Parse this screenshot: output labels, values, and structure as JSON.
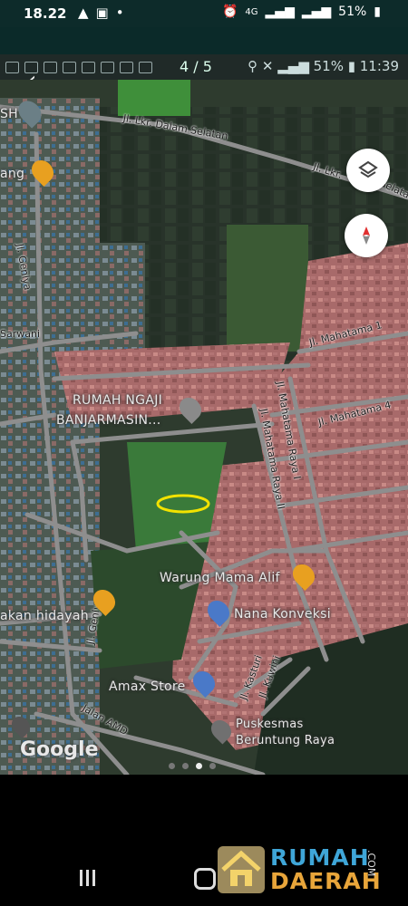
{
  "status_bar": {
    "time": "18.22",
    "battery": "51%",
    "network": "4G"
  },
  "photo_status_bar": {
    "counter": "4 / 5",
    "battery": "51%",
    "time": "11:39"
  },
  "map": {
    "road_labels": [
      "Jl. Lkr. Dalam Selatan",
      "Jl. Lkr.",
      "Selata",
      "Jl. Genlya",
      "Sarwani",
      "Jl. Mahatama 1",
      "Jl. Mahatama 4",
      "Jl. Mahatama Raya I",
      "Jl. Mahatama Raya II",
      "Jl. Genlya",
      "Jalan AMD",
      "Jl. Kasturi",
      "Jl. Kuwini"
    ],
    "places": [
      {
        "name": "RUMAH NGAJI",
        "name2": "BANJARMASIN..."
      },
      {
        "name": "Warung Mama Alif"
      },
      {
        "name": "Nana Konveksi"
      },
      {
        "name": "akan hidayah"
      },
      {
        "name": "Amax Store"
      },
      {
        "name": "Puskesmas",
        "name2": "Beruntung Raya"
      }
    ],
    "edge_labels": [
      "SH",
      "ang"
    ],
    "brand": "Google"
  },
  "pager": {
    "count": 4,
    "active_index": 2
  },
  "watermark": {
    "line1": "RUMAH",
    "line2": "DAERAH",
    "suffix": ".COM"
  },
  "colors": {
    "highlight": "#f2e200",
    "fab_bg": "#ffffff"
  }
}
